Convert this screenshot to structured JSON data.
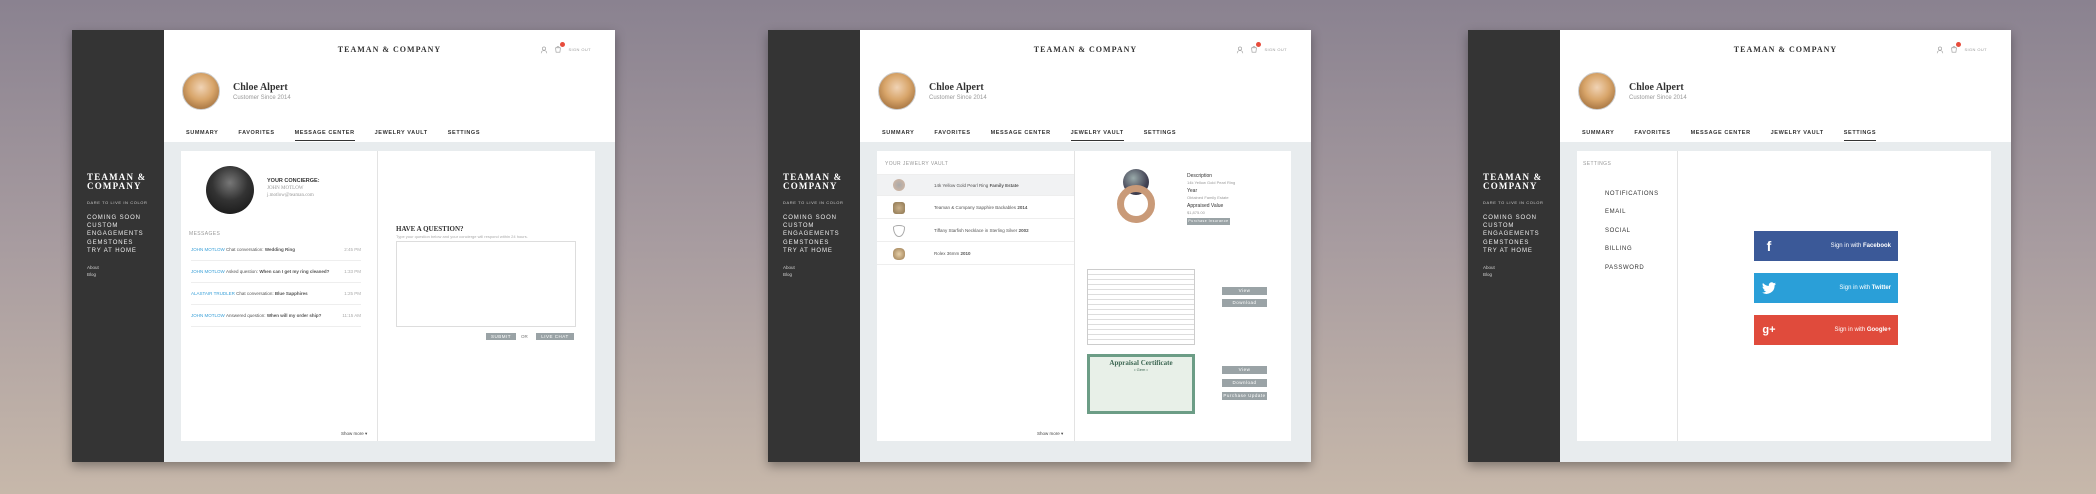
{
  "brand": {
    "name": "TEAMAN & COMPANY",
    "logo_line1": "TEAMAN &",
    "logo_line2": "COMPANY",
    "tagline": "DARE TO LIVE IN COLOR"
  },
  "sidebar": {
    "items": [
      "COMING SOON",
      "CUSTOM",
      "ENGAGEMENTS",
      "GEMSTONES",
      "TRY AT HOME"
    ],
    "small": [
      "About",
      "Blog"
    ]
  },
  "header": {
    "signout": "SIGN OUT",
    "cart_count": "1"
  },
  "user": {
    "name": "Chloe Alpert",
    "since": "Customer Since 2014"
  },
  "tabs": [
    "SUMMARY",
    "FAVORITES",
    "MESSAGE CENTER",
    "JEWELRY VAULT",
    "SETTINGS"
  ],
  "message_center": {
    "concierge_label": "YOUR CONCIERGE:",
    "concierge_name": "JOHN MOTLOW",
    "concierge_email": "j.motlow@teaman.com",
    "messages_label": "MESSAGES",
    "messages": [
      {
        "from": "JOHN MOTLOW",
        "action": "Chat conversation:",
        "subject": "Wedding Ring",
        "time": "2:45 PM"
      },
      {
        "from": "JOHN MOTLOW",
        "action": "Asked question:",
        "subject": "When can I get my ring cleaned?",
        "time": "1:33 PM"
      },
      {
        "from": "ALASTAIR TRUDLER",
        "action": "Chat conversation:",
        "subject": "Blue Sapphires",
        "time": "1:25 PM"
      },
      {
        "from": "JOHN MOTLOW",
        "action": "Answered question:",
        "subject": "When will my order ship?",
        "time": "11:15 AM"
      }
    ],
    "question_title": "HAVE A QUESTION?",
    "question_hint": "Type your question below and your concierge will respond within 24 hours.",
    "submit": "SUBMIT",
    "or": "OR",
    "live_chat": "LIVE CHAT",
    "show_more": "Show more ▾"
  },
  "vault": {
    "label": "YOUR JEWELRY VAULT",
    "items": [
      {
        "name": "14k Yellow Gold Pearl Ring",
        "bold": "Family Estate"
      },
      {
        "name": "Teaman & Company Sapphire Backables",
        "bold": "2014"
      },
      {
        "name": "Tiffany Starfish Necklace in Sterling Silver",
        "bold": "2002"
      },
      {
        "name": "Rolex 36mm",
        "bold": "2010"
      }
    ],
    "detail": {
      "desc_label": "Description",
      "desc": "14k Yellow Gold Pearl Ring",
      "year_label": "Year",
      "year": "Obtained Family Estate",
      "value_label": "Appraised Value",
      "value": "$1,875.00",
      "purchase_btn": "Purchase Insurance"
    },
    "view": "View",
    "download": "Download",
    "purchase_update": "Purchase Update",
    "cert_title": "Appraisal Certificate",
    "cert_sub": "• Gem •",
    "show_more": "Show more ▾"
  },
  "settings": {
    "label": "SETTINGS",
    "items": [
      "NOTIFICATIONS",
      "EMAIL",
      "SOCIAL",
      "BILLING",
      "PASSWORD"
    ],
    "social": [
      {
        "pre": "Sign in with",
        "name": "Facebook",
        "color": "#3b5998"
      },
      {
        "pre": "Sign in with",
        "name": "Twitter",
        "color": "#2a9fd8"
      },
      {
        "pre": "Sign in with",
        "name": "Google+",
        "color": "#e04b3c"
      }
    ]
  }
}
